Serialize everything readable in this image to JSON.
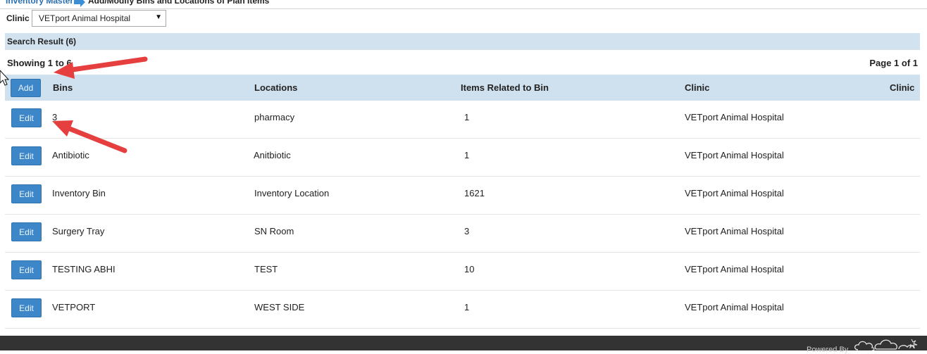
{
  "breadcrumb": {
    "parent": "Inventory Master",
    "current": "Add/Modify Bins and Locations of Plan Items"
  },
  "filter": {
    "clinic_label": "Clinic",
    "clinic_value": "VETport Animal Hospital"
  },
  "results": {
    "title": "Search Result (6)",
    "showing": "Showing 1 to 6",
    "page": "Page 1 of 1"
  },
  "table": {
    "add_label": "Add",
    "edit_label": "Edit",
    "headers": [
      "Bins",
      "Locations",
      "Items Related to Bin",
      "Clinic",
      "Clinic"
    ],
    "rows": [
      {
        "bin": "3",
        "location": "pharmacy",
        "items": "1",
        "clinic": "VETport Animal Hospital"
      },
      {
        "bin": "Antibiotic",
        "location": "Anitbiotic",
        "items": "1",
        "clinic": "VETport Animal Hospital"
      },
      {
        "bin": "Inventory Bin",
        "location": "Inventory Location",
        "items": "1621",
        "clinic": "VETport Animal Hospital"
      },
      {
        "bin": "Surgery Tray",
        "location": "SN Room",
        "items": "3",
        "clinic": "VETport Animal Hospital"
      },
      {
        "bin": "TESTING ABHI",
        "location": "TEST",
        "items": "10",
        "clinic": "VETport Animal Hospital"
      },
      {
        "bin": "VETPORT",
        "location": "WEST SIDE",
        "items": "1",
        "clinic": "VETport Animal Hospital"
      }
    ]
  },
  "footer": {
    "powered_by": "Powered By"
  },
  "colors": {
    "accent": "#3d87c8",
    "header_bg": "#cfe0ee",
    "annotation_arrow": "#e5403f",
    "footer_bg": "#333333"
  },
  "icons": [
    "breadcrumb-arrow-icon",
    "dropdown-arrow-icon",
    "mouse-cursor-icon",
    "annotation-arrow-icon",
    "cloud-logo-icon"
  ]
}
